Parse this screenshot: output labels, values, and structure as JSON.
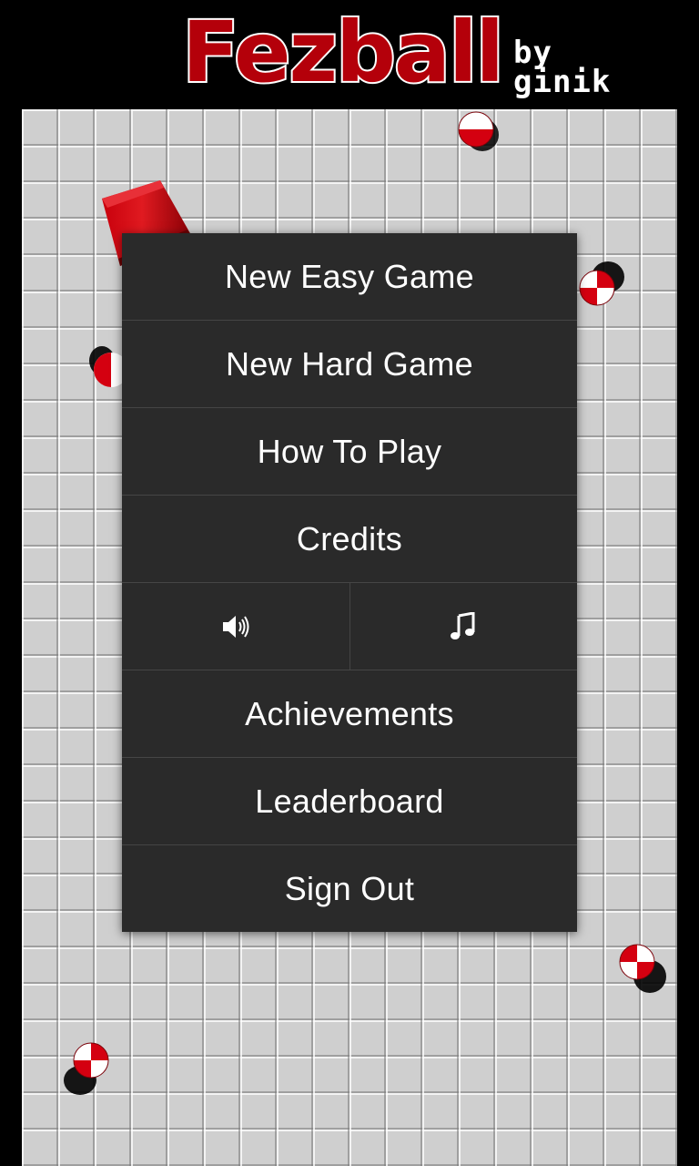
{
  "header": {
    "title": "Fezball",
    "by": "by",
    "author": "ginik"
  },
  "colors": {
    "accent_red": "#b4000a",
    "menu_bg": "#2a2a2a",
    "divider": "#454545",
    "board_tile": "#cfcfcf"
  },
  "menu": {
    "new_easy_game": "New Easy Game",
    "new_hard_game": "New Hard Game",
    "how_to_play": "How To Play",
    "credits": "Credits",
    "sound_toggle_icon": "speaker-icon",
    "music_toggle_icon": "music-note-icon",
    "achievements": "Achievements",
    "leaderboard": "Leaderboard",
    "sign_out": "Sign Out"
  }
}
